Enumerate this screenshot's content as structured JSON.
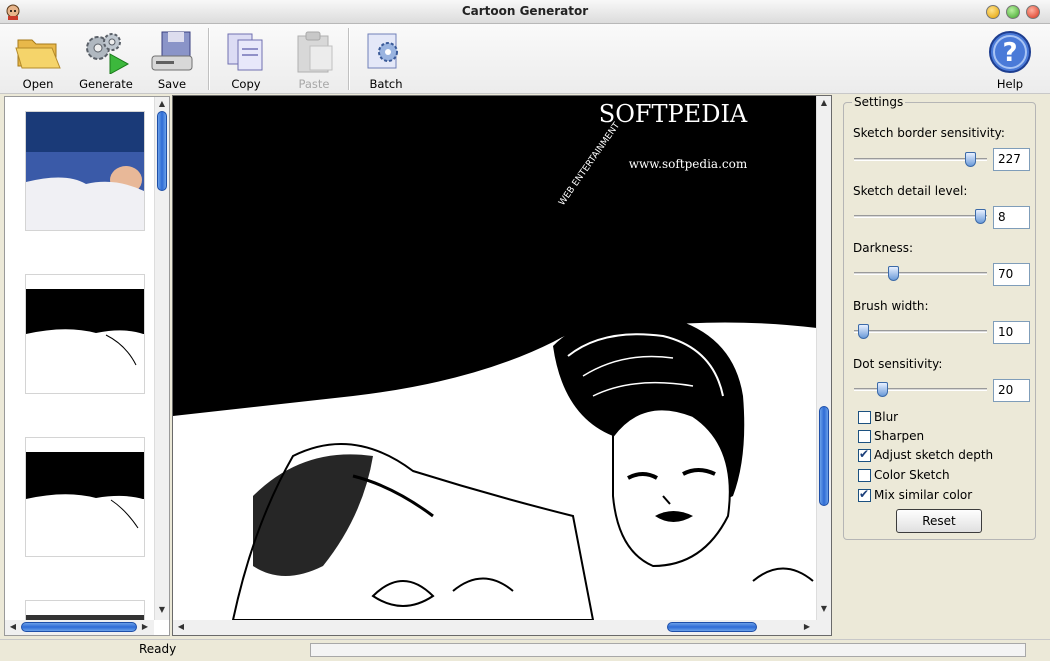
{
  "window": {
    "title": "Cartoon Generator"
  },
  "toolbar": {
    "open": "Open",
    "generate": "Generate",
    "save": "Save",
    "copy": "Copy",
    "paste": "Paste",
    "batch": "Batch",
    "help": "Help"
  },
  "canvas": {
    "watermark": "SOFTPEDIA",
    "url": "www.softpedia.com",
    "sub": "WEB ENTERTAINMENT"
  },
  "settings": {
    "legend": "Settings",
    "sliders": [
      {
        "label": "Sketch border sensitivity:",
        "value": "227",
        "fraction": 0.87
      },
      {
        "label": "Sketch detail level:",
        "value": "8",
        "fraction": 0.95
      },
      {
        "label": "Darkness:",
        "value": "70",
        "fraction": 0.29
      },
      {
        "label": "Brush width:",
        "value": "10",
        "fraction": 0.07
      },
      {
        "label": "Dot sensitivity:",
        "value": "20",
        "fraction": 0.21
      }
    ],
    "checkboxes": [
      {
        "label": "Blur",
        "checked": false
      },
      {
        "label": "Sharpen",
        "checked": false
      },
      {
        "label": "Adjust sketch depth",
        "checked": true
      },
      {
        "label": "Color Sketch",
        "checked": false
      },
      {
        "label": "Mix similar color",
        "checked": true
      }
    ],
    "reset": "Reset"
  },
  "status": {
    "text": "Ready"
  }
}
